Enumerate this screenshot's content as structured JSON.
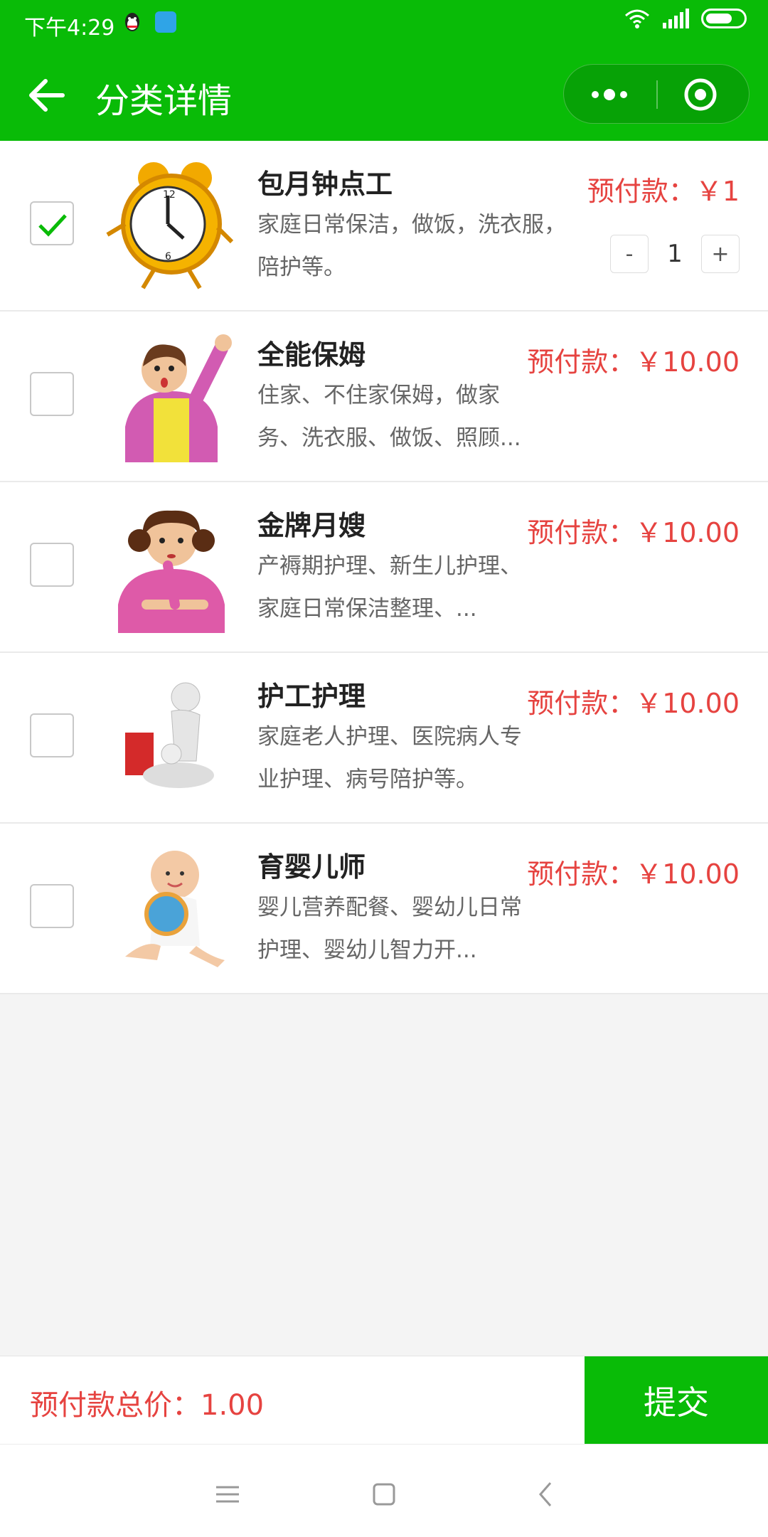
{
  "status_bar": {
    "time": "下午4:29"
  },
  "header": {
    "title": "分类详情"
  },
  "items": [
    {
      "name": "包月钟点工",
      "desc": "家庭日常保洁，做饭，洗衣服，陪护等。",
      "price": "预付款：￥1",
      "checked": true,
      "quantity": "1",
      "image": "alarm-clock-image"
    },
    {
      "name": "全能保姆",
      "desc": "住家、不住家保姆，做家务、洗衣服、做饭、照顾...",
      "price": "预付款：￥10.00",
      "checked": false,
      "image": "nanny-cartoon-image"
    },
    {
      "name": "金牌月嫂",
      "desc": "产褥期护理、新生儿护理、家庭日常保洁整理、...",
      "price": "预付款：￥10.00",
      "checked": false,
      "image": "maternity-nurse-cartoon-image"
    },
    {
      "name": "护工护理",
      "desc": "家庭老人护理、医院病人专业护理、病号陪护等。",
      "price": "预付款：￥10.00",
      "checked": false,
      "image": "caregiver-figure-image"
    },
    {
      "name": "育婴儿师",
      "desc": "婴儿营养配餐、婴幼儿日常护理、婴幼儿智力开...",
      "price": "预付款：￥10.00",
      "checked": false,
      "image": "baby-photo-image"
    }
  ],
  "stepper": {
    "minus": "-",
    "plus": "+"
  },
  "footer": {
    "total": "预付款总价：1.00",
    "submit": "提交"
  },
  "colors": {
    "brand": "#09bb07",
    "price": "#e64340"
  }
}
